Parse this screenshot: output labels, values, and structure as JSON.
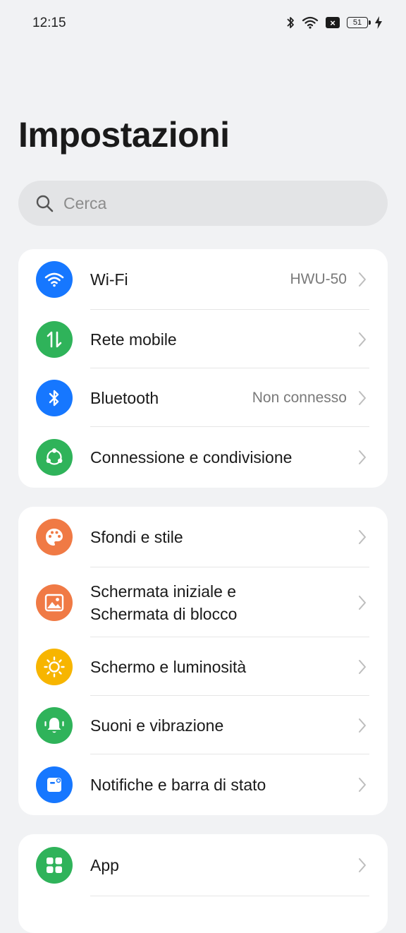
{
  "status_bar": {
    "time": "12:15",
    "battery": "51"
  },
  "header": {
    "title": "Impostazioni"
  },
  "search": {
    "placeholder": "Cerca"
  },
  "colors": {
    "blue": "#1677ff",
    "green": "#2fb35a",
    "orange": "#f07a45",
    "yellow": "#f7b500"
  },
  "groups": [
    {
      "items": [
        {
          "label": "Wi-Fi",
          "value": "HWU-50",
          "icon": "wifi-icon"
        },
        {
          "label": "Rete mobile",
          "value": "",
          "icon": "mobile-data-icon"
        },
        {
          "label": "Bluetooth",
          "value": "Non connesso",
          "icon": "bluetooth-icon"
        },
        {
          "label": "Connessione e condivisione",
          "value": "",
          "icon": "share-icon"
        }
      ]
    },
    {
      "items": [
        {
          "label": "Sfondi e stile",
          "icon": "palette-icon"
        },
        {
          "label_line1": "Schermata iniziale e",
          "label_line2": "Schermata di blocco",
          "icon": "picture-icon"
        },
        {
          "label": "Schermo e luminosità",
          "icon": "brightness-icon"
        },
        {
          "label": "Suoni e vibrazione",
          "icon": "bell-icon"
        },
        {
          "label": "Notifiche e barra di stato",
          "icon": "notification-icon"
        }
      ]
    },
    {
      "items": [
        {
          "label": "App",
          "icon": "apps-grid-icon"
        }
      ]
    }
  ]
}
